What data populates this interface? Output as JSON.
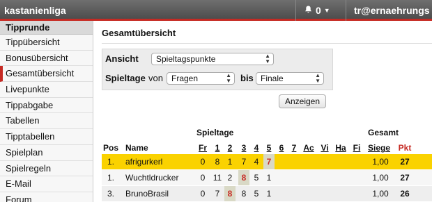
{
  "topbar": {
    "brand": "kastanienliga",
    "notifications": "0",
    "user": "tr@ernaehrungs"
  },
  "sidebar": {
    "header": "Tipprunde",
    "items": [
      {
        "label": "Tippübersicht"
      },
      {
        "label": "Bonusübersicht"
      },
      {
        "label": "Gesamtübersicht",
        "active": true
      },
      {
        "label": "Livepunkte"
      },
      {
        "label": "Tippabgabe"
      },
      {
        "label": "Tabellen"
      },
      {
        "label": "Tipptabellen"
      },
      {
        "label": "Spielplan"
      },
      {
        "label": "Spielregeln"
      },
      {
        "label": "E-Mail"
      },
      {
        "label": "Forum"
      }
    ]
  },
  "main": {
    "title": "Gesamtübersicht",
    "filter": {
      "view_label": "Ansicht",
      "view_value": "Spieltagspunkte",
      "matchdays_label": "Spieltage",
      "from_label": "von",
      "from_value": "Fragen",
      "to_label": "bis",
      "to_value": "Finale",
      "submit_label": "Anzeigen"
    },
    "table": {
      "group_matchdays": "Spieltage",
      "group_total": "Gesamt",
      "col_pos": "Pos",
      "col_name": "Name",
      "matchday_cols": [
        "Fr",
        "1",
        "2",
        "3",
        "4",
        "5",
        "6",
        "7",
        "Ac",
        "Vi",
        "Ha",
        "Fi"
      ],
      "col_wins": "Siege",
      "col_points": "Pkt",
      "rows": [
        {
          "pos": "1.",
          "name": "afrigurkerl",
          "md": [
            "0",
            "8",
            "1",
            "7",
            "4",
            "7",
            "",
            "",
            "",
            "",
            "",
            ""
          ],
          "best": [
            5
          ],
          "wins": "1,00",
          "points": "27",
          "highlight": true
        },
        {
          "pos": "1.",
          "name": "Wuchtldrucker",
          "md": [
            "0",
            "11",
            "2",
            "8",
            "5",
            "1",
            "",
            "",
            "",
            "",
            "",
            ""
          ],
          "best": [
            3
          ],
          "wins": "1,00",
          "points": "27",
          "highlight": false
        },
        {
          "pos": "3.",
          "name": "BrunoBrasil",
          "md": [
            "0",
            "7",
            "8",
            "8",
            "5",
            "1",
            "",
            "",
            "",
            "",
            "",
            ""
          ],
          "best": [
            2
          ],
          "wins": "1,00",
          "points": "26",
          "highlight": false
        }
      ]
    }
  },
  "colors": {
    "accent_red": "#c62a23",
    "highlight_row": "#fad200",
    "topbar": "#5a5a5a"
  }
}
